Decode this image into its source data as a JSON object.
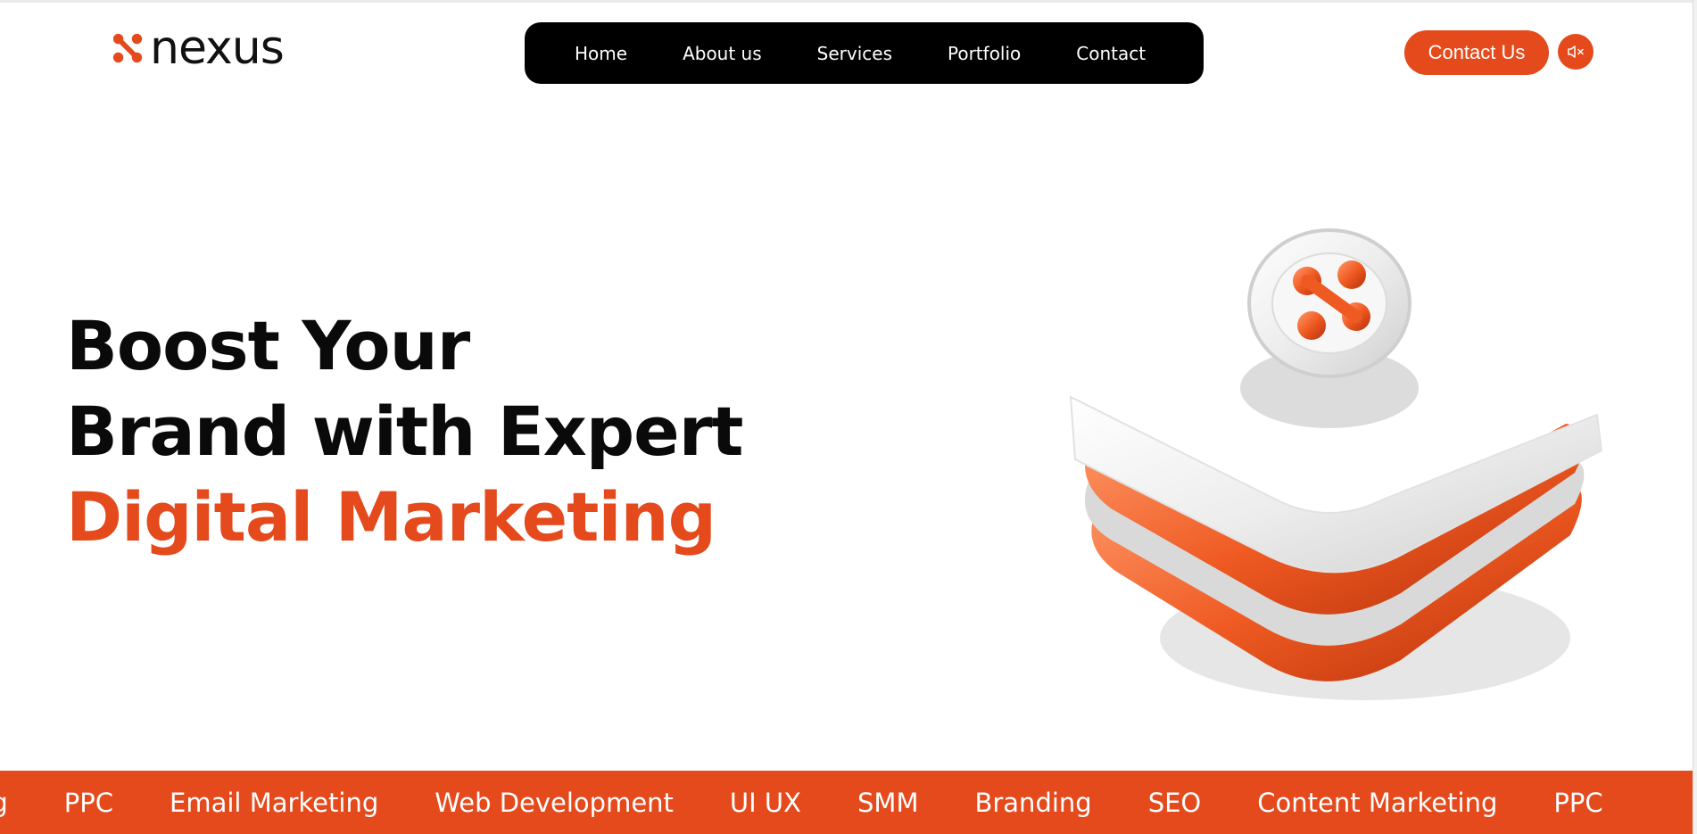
{
  "brand": {
    "name": "nexus",
    "accent_color": "#e44a1c",
    "text_color": "#111111"
  },
  "nav": {
    "items": [
      {
        "label": "Home"
      },
      {
        "label": "About us"
      },
      {
        "label": "Services"
      },
      {
        "label": "Portfolio"
      },
      {
        "label": "Contact"
      }
    ]
  },
  "header": {
    "contact_button_label": "Contact Us",
    "mute_icon": "speaker-muted-icon"
  },
  "hero": {
    "line1": "Boost Your",
    "line2": "Brand with Expert",
    "line3": "Digital Marketing",
    "illustration": "glass-and-orange-3d-logo-illustration"
  },
  "marquee": {
    "items": [
      "ng",
      "PPC",
      "Email Marketing",
      "Web Development",
      "UI UX",
      "SMM",
      "Branding",
      "SEO",
      "Content Marketing",
      "PPC"
    ]
  }
}
